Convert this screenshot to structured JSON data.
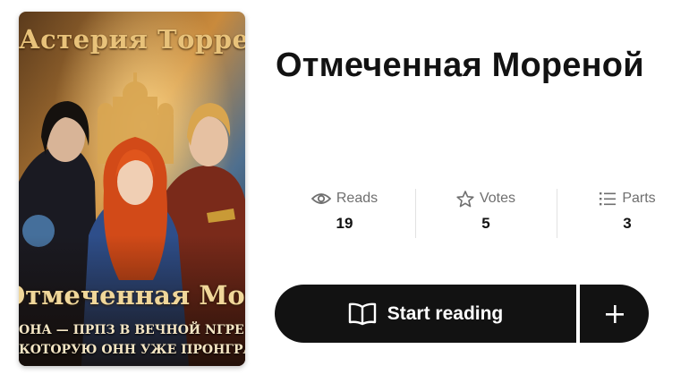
{
  "cover": {
    "author_text": "Астерия Торрен",
    "title_text": "Отмеченная Мореной",
    "tagline_line1": "ОНА — ПРПЗ В ВЕЧНОЙ NГРЕ БОГОВ,",
    "tagline_line2": "КОТОРУЮ ОНН УЖЕ ПРОНГРАЛN"
  },
  "story": {
    "title": "Отмеченная Мореной"
  },
  "stats": [
    {
      "label": "Reads",
      "value": "19",
      "icon": "eye-icon"
    },
    {
      "label": "Votes",
      "value": "5",
      "icon": "star-icon"
    },
    {
      "label": "Parts",
      "value": "3",
      "icon": "list-icon"
    }
  ],
  "actions": {
    "start_reading_label": "Start reading",
    "add_icon": "plus-icon"
  },
  "colors": {
    "button_bg": "#121212",
    "text_primary": "#121212",
    "text_muted": "#6f6f6f"
  }
}
